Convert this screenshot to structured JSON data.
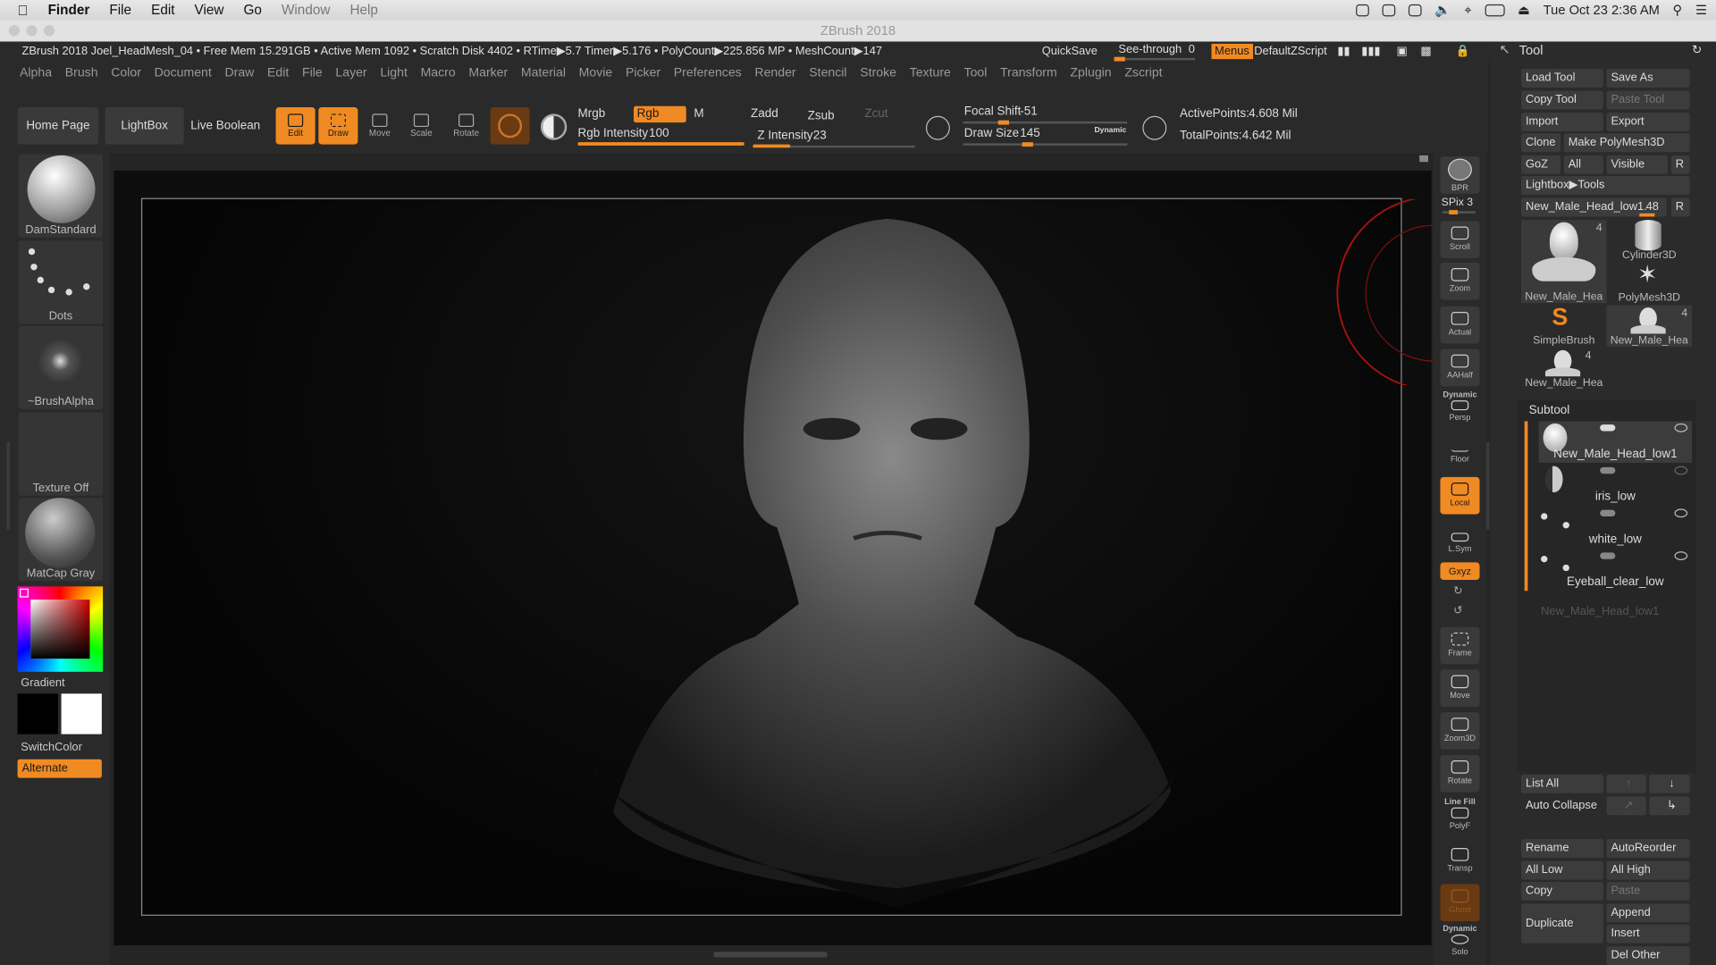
{
  "macbar": {
    "apple": "",
    "finder": "Finder",
    "menus": [
      "File",
      "Edit",
      "View",
      "Go",
      "Window",
      "Help"
    ],
    "clock": "Tue Oct 23  2:36 AM"
  },
  "window": {
    "title": "ZBrush 2018"
  },
  "info": {
    "text": "ZBrush 2018 Joel_HeadMesh_04  • Free Mem 15.291GB • Active Mem 1092 • Scratch Disk 4402 •  RTime▶5.7 Timer▶5.176 • PolyCount▶225.856 MP  • MeshCount▶147",
    "quicksave": "QuickSave",
    "seethrough": "See-through",
    "seethrough_value": "0",
    "menus": "Menus",
    "script": "DefaultZScript"
  },
  "mainmenu": [
    "Alpha",
    "Brush",
    "Color",
    "Document",
    "Draw",
    "Edit",
    "File",
    "Layer",
    "Light",
    "Macro",
    "Marker",
    "Material",
    "Movie",
    "Picker",
    "Preferences",
    "Render",
    "Stencil",
    "Stroke",
    "Texture",
    "Tool",
    "Transform",
    "Zplugin",
    "Zscript"
  ],
  "toolbar": {
    "home": "Home Page",
    "lightbox": "LightBox",
    "liveboolean": "Live Boolean",
    "edit": "Edit",
    "draw": "Draw",
    "move": "Move",
    "scale": "Scale",
    "rotate": "Rotate",
    "mrgb": "Mrgb",
    "rgb": "Rgb",
    "m": "M",
    "zadd": "Zadd",
    "zsub": "Zsub",
    "zcut": "Zcut",
    "rgb_intensity_label": "Rgb Intensity",
    "rgb_intensity": "100",
    "z_intensity_label": "Z Intensity",
    "z_intensity": "23",
    "focal_label": "Focal Shift",
    "focal": "-51",
    "drawsize_label": "Draw Size",
    "drawsize": "145",
    "dynamic": "Dynamic",
    "activepoints_label": "ActivePoints:",
    "activepoints": "4.608 Mil",
    "totalpoints_label": "TotalPoints:",
    "totalpoints": "4.642 Mil"
  },
  "leftshelf": {
    "brush": "DamStandard",
    "stroke": "Dots",
    "alpha": "~BrushAlpha",
    "texture": "Texture Off",
    "material": "MatCap Gray",
    "gradient": "Gradient",
    "switchcolor": "SwitchColor",
    "alternate": "Alternate"
  },
  "rightshelf": {
    "bpr": "BPR",
    "spix": "SPix 3",
    "scroll": "Scroll",
    "zoom": "Zoom",
    "actual": "Actual",
    "aahalf": "AAHalf",
    "dynamic": "Dynamic",
    "persp": "Persp",
    "floor": "Floor",
    "local": "Local",
    "lsym": "L.Sym",
    "xyz": "Gxyz",
    "frame": "Frame",
    "move": "Move",
    "zoom3d": "Zoom3D",
    "rotate": "Rotate",
    "linefill": "Line Fill",
    "polyf": "PolyF",
    "transp": "Transp",
    "ghost": "Ghost",
    "solo": "Solo"
  },
  "toolpanel": {
    "title": "Tool",
    "buttons": {
      "load": "Load Tool",
      "saveas": "Save As",
      "copy": "Copy Tool",
      "paste": "Paste Tool",
      "import": "Import",
      "export": "Export",
      "clone": "Clone",
      "makepoly": "Make PolyMesh3D",
      "goz": "GoZ",
      "all": "All",
      "visible": "Visible",
      "r": "R",
      "lightbox": "Lightbox▶Tools",
      "current": "New_Male_Head_low1.",
      "current_num": "48",
      "r2": "R"
    },
    "tools": [
      {
        "name": "New_Male_Hea",
        "count": "4"
      },
      {
        "name": "Cylinder3D"
      },
      {
        "name": "PolyMesh3D"
      },
      {
        "name": "SimpleBrush"
      },
      {
        "name": "New_Male_Hea",
        "count": "4"
      },
      {
        "name": "New_Male_Hea",
        "count": "4"
      }
    ],
    "subtool_title": "Subtool",
    "subtools": [
      "New_Male_Head_low1",
      "iris_low",
      "white_low",
      "Eyeball_clear_low"
    ],
    "subtool_extra": "New_Male_Head_low1",
    "lower": {
      "listall": "List All",
      "autocollapse": "Auto Collapse",
      "rename": "Rename",
      "autoreorder": "AutoReorder",
      "alllow": "All Low",
      "allhigh": "All High",
      "copy": "Copy",
      "paste": "Paste",
      "duplicate": "Duplicate",
      "append": "Append",
      "insert": "Insert",
      "delother": "Del Other"
    }
  },
  "colors": {
    "accent": "#f08a22",
    "panel": "#2b2b2b",
    "canvas": "#0d0d0d"
  }
}
